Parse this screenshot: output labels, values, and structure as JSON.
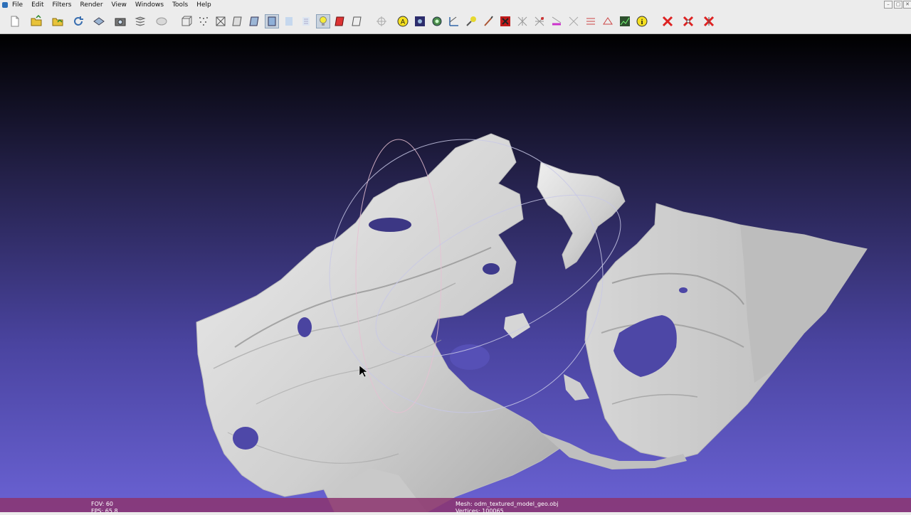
{
  "menu": {
    "items": [
      "File",
      "Edit",
      "Filters",
      "Render",
      "View",
      "Windows",
      "Tools",
      "Help"
    ]
  },
  "window_controls": {
    "minimize": "–",
    "restore": "▢",
    "close": "✕"
  },
  "toolbar": {
    "buttons": [
      "new-project",
      "open-project",
      "import-mesh",
      "reload",
      "export-mesh",
      "snapshot",
      "layers",
      "global-view",
      "bounding-box",
      "points",
      "wireframe",
      "hidden-lines",
      "flat-lines",
      "flat",
      "smooth",
      "texture",
      "light",
      "backface",
      "doublesided",
      "pick-points",
      "annotations",
      "measure-tool",
      "rotate-selection",
      "align",
      "paint",
      "z-painting",
      "select-faces",
      "select-vertices",
      "select-connected",
      "select-faces-rect",
      "select-vertices-rect",
      "quality-mapper",
      "info",
      "delete-faces",
      "delete-vertices",
      "delete-all"
    ]
  },
  "viewport": {
    "background_top": "#000000",
    "background_bottom": "#6a62d4",
    "mesh_color": "#d8d8d8"
  },
  "status": {
    "fov": "FOV: 60",
    "fps": "FPS:   65.8",
    "mesh": "Mesh: odm_textured_model_geo.obj",
    "vertices": "Vertices: 100065"
  },
  "colors": {
    "statusbar": "#8c346e",
    "toolbar_bg": "#ececec"
  }
}
